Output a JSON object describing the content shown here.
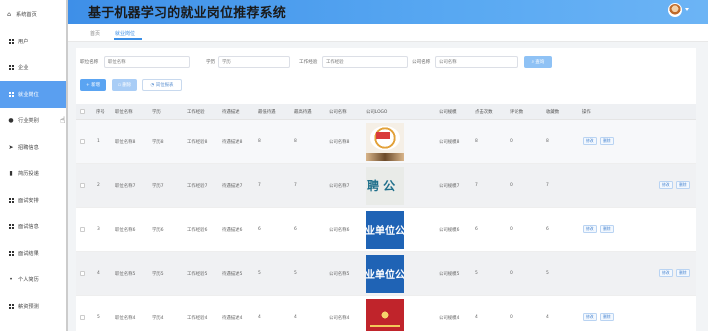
{
  "app": {
    "title": "基于机器学习的就业岗位推荐系统"
  },
  "sidebar": {
    "items": [
      {
        "label": "系统首页",
        "icon": "home-icon"
      },
      {
        "label": "用户",
        "icon": "grid-icon"
      },
      {
        "label": "企业",
        "icon": "grid-icon"
      },
      {
        "label": "就业岗位",
        "icon": "grid-icon",
        "active": true
      },
      {
        "label": "行业类别",
        "icon": "pin-icon"
      },
      {
        "label": "招聘信息",
        "icon": "send-icon"
      },
      {
        "label": "简历投递",
        "icon": "bar-chart-icon"
      },
      {
        "label": "面试安排",
        "icon": "grid-icon"
      },
      {
        "label": "面试信息",
        "icon": "grid-icon"
      },
      {
        "label": "面试结果",
        "icon": "grid-icon"
      },
      {
        "label": "个人简历",
        "icon": "person-icon"
      },
      {
        "label": "薪资预测",
        "icon": "grid-icon"
      }
    ]
  },
  "breadcrumb": {
    "home": "首页",
    "current": "就业岗位"
  },
  "filters": {
    "job_name_label": "职位名称",
    "job_name_placeholder": "职位名称",
    "education_label": "学历",
    "education_placeholder": "学历",
    "experience_label": "工作经验",
    "experience_placeholder": "工作经验",
    "company_label": "公司名称",
    "company_placeholder": "公司名称",
    "search_label": "查询"
  },
  "actions": {
    "add": "新增",
    "delete": "删除",
    "report": "岗位报表"
  },
  "table": {
    "headers": [
      "序号",
      "职位名称",
      "学历",
      "工作经验",
      "待遇描述",
      "最低待遇",
      "最高待遇",
      "公司名称",
      "公司LOGO",
      "公司规模",
      "点击次数",
      "评论数",
      "收藏数",
      "操作"
    ],
    "rows": [
      {
        "no": "1",
        "name": "职位名称8",
        "edu": "学历8",
        "exp": "工作经验8",
        "desc": "待遇描述8",
        "min": "8",
        "max": "8",
        "company": "公司名称8",
        "logo": "logo-pink",
        "scale": "公司规模8",
        "clicks": "8",
        "comments": "0",
        "favs": "8"
      },
      {
        "no": "2",
        "name": "职位名称7",
        "edu": "学历7",
        "exp": "工作经验7",
        "desc": "待遇描述7",
        "min": "7",
        "max": "7",
        "company": "公司名称7",
        "logo": "logo-recruit",
        "logo_text": "聘 公",
        "scale": "公司规模7",
        "clicks": "7",
        "comments": "0",
        "favs": "7"
      },
      {
        "no": "3",
        "name": "职位名称6",
        "edu": "学历6",
        "exp": "工作经验6",
        "desc": "待遇描述6",
        "min": "6",
        "max": "6",
        "company": "公司名称6",
        "logo": "logo-blue",
        "logo_text": "业单位公",
        "scale": "公司规模6",
        "clicks": "6",
        "comments": "0",
        "favs": "6"
      },
      {
        "no": "4",
        "name": "职位名称5",
        "edu": "学历5",
        "exp": "工作经验5",
        "desc": "待遇描述5",
        "min": "5",
        "max": "5",
        "company": "公司名称5",
        "logo": "logo-blue",
        "logo_text": "业单位公",
        "scale": "公司规模5",
        "clicks": "5",
        "comments": "0",
        "favs": "5"
      },
      {
        "no": "5",
        "name": "职位名称4",
        "edu": "学历4",
        "exp": "工作经验4",
        "desc": "待遇描述4",
        "min": "4",
        "max": "4",
        "company": "公司名称4",
        "logo": "logo-red",
        "scale": "公司规模4",
        "clicks": "4",
        "comments": "0",
        "favs": "4"
      }
    ],
    "row_actions": {
      "edit": "修改",
      "delete": "删除"
    }
  }
}
